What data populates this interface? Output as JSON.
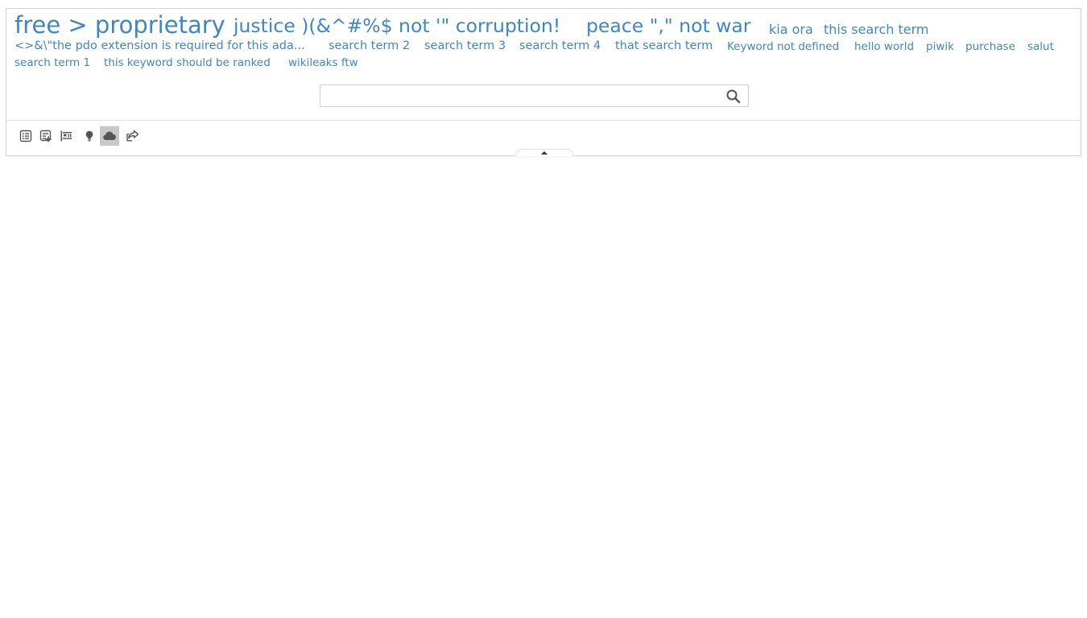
{
  "tag_cloud": {
    "tags": [
      {
        "label": "free > proprietary"
      },
      {
        "label": "justice )(&^#%$ not '\" corruption!"
      },
      {
        "label": "peace \",\" not war"
      },
      {
        "label": "kia ora"
      },
      {
        "label": "this search term"
      },
      {
        "label": "<>&\\\"the pdo extension is required for this ada..."
      },
      {
        "label": "search term 2"
      },
      {
        "label": "search term 3"
      },
      {
        "label": "search term 4"
      },
      {
        "label": "that search term"
      },
      {
        "label": "Keyword not defined"
      },
      {
        "label": "hello world"
      },
      {
        "label": "piwik"
      },
      {
        "label": "purchase"
      },
      {
        "label": "salut"
      },
      {
        "label": "search term 1"
      },
      {
        "label": "this keyword should be ranked"
      },
      {
        "label": "wikileaks ftw"
      }
    ]
  },
  "search": {
    "value": "",
    "placeholder": "",
    "button_icon": "search-icon"
  },
  "footer": {
    "visualizations": [
      {
        "icon": "table-icon",
        "active": false
      },
      {
        "icon": "table-more-columns-icon",
        "active": false
      },
      {
        "icon": "table-goals-icon",
        "active": false
      },
      {
        "icon": "insights-icon",
        "active": false
      },
      {
        "icon": "tag-cloud-icon",
        "active": true
      },
      {
        "icon": "export-icon",
        "active": false
      }
    ],
    "active_color": "#c8c8c8"
  },
  "theme": {
    "link_color": "#3f86c6",
    "border_color": "#d4d4d4",
    "icon_color": "#555555"
  }
}
